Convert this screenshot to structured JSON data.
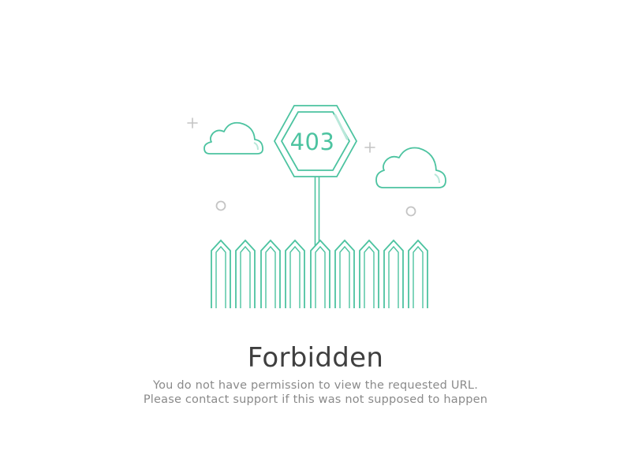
{
  "illustration": {
    "sign_code": "403",
    "accent_color": "#4cc3a0",
    "decoration_color": "#c4c4c4"
  },
  "content": {
    "title": "Forbidden",
    "message_line1": "You do not have permission to view the requested URL.",
    "message_line2": "Please contact support if this was not supposed to happen"
  }
}
